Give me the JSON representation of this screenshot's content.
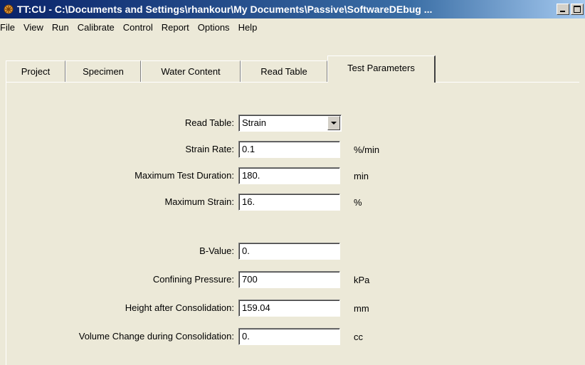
{
  "window": {
    "title": "TT:CU - C:\\Documents and Settings\\rhankour\\My Documents\\Passive\\SoftwareDEbug ..."
  },
  "menu": [
    {
      "label": "File"
    },
    {
      "label": "View"
    },
    {
      "label": "Run"
    },
    {
      "label": "Calibrate"
    },
    {
      "label": "Control"
    },
    {
      "label": "Report"
    },
    {
      "label": "Options"
    },
    {
      "label": "Help"
    }
  ],
  "tabs": [
    {
      "label": "Project"
    },
    {
      "label": "Specimen"
    },
    {
      "label": "Water Content"
    },
    {
      "label": "Read Table"
    },
    {
      "label": "Test Parameters"
    }
  ],
  "active_tab": "Test Parameters",
  "form": {
    "read_table": {
      "label": "Read Table:",
      "value": "Strain"
    },
    "strain_rate": {
      "label": "Strain Rate:",
      "value": "0.1",
      "unit": "%/min"
    },
    "max_duration": {
      "label": "Maximum Test Duration:",
      "value": "180.",
      "unit": "min"
    },
    "max_strain": {
      "label": "Maximum Strain:",
      "value": "16.",
      "unit": "%"
    },
    "b_value": {
      "label": "B-Value:",
      "value": "0."
    },
    "confining_pressure": {
      "label": "Confining Pressure:",
      "value": "700",
      "unit": "kPa"
    },
    "height_after": {
      "label": "Height after Consolidation:",
      "value": "159.04",
      "unit": "mm"
    },
    "volume_change": {
      "label": "Volume Change during Consolidation:",
      "value": "0.",
      "unit": "cc"
    }
  },
  "icons": {
    "app": "app-icon",
    "minimize": "minimize-icon",
    "maximize": "maximize-icon",
    "dropdown": "chevron-down-icon"
  },
  "colors": {
    "titlebar_start": "#0a246a",
    "titlebar_end": "#a6caf0",
    "face": "#ece9d8"
  }
}
